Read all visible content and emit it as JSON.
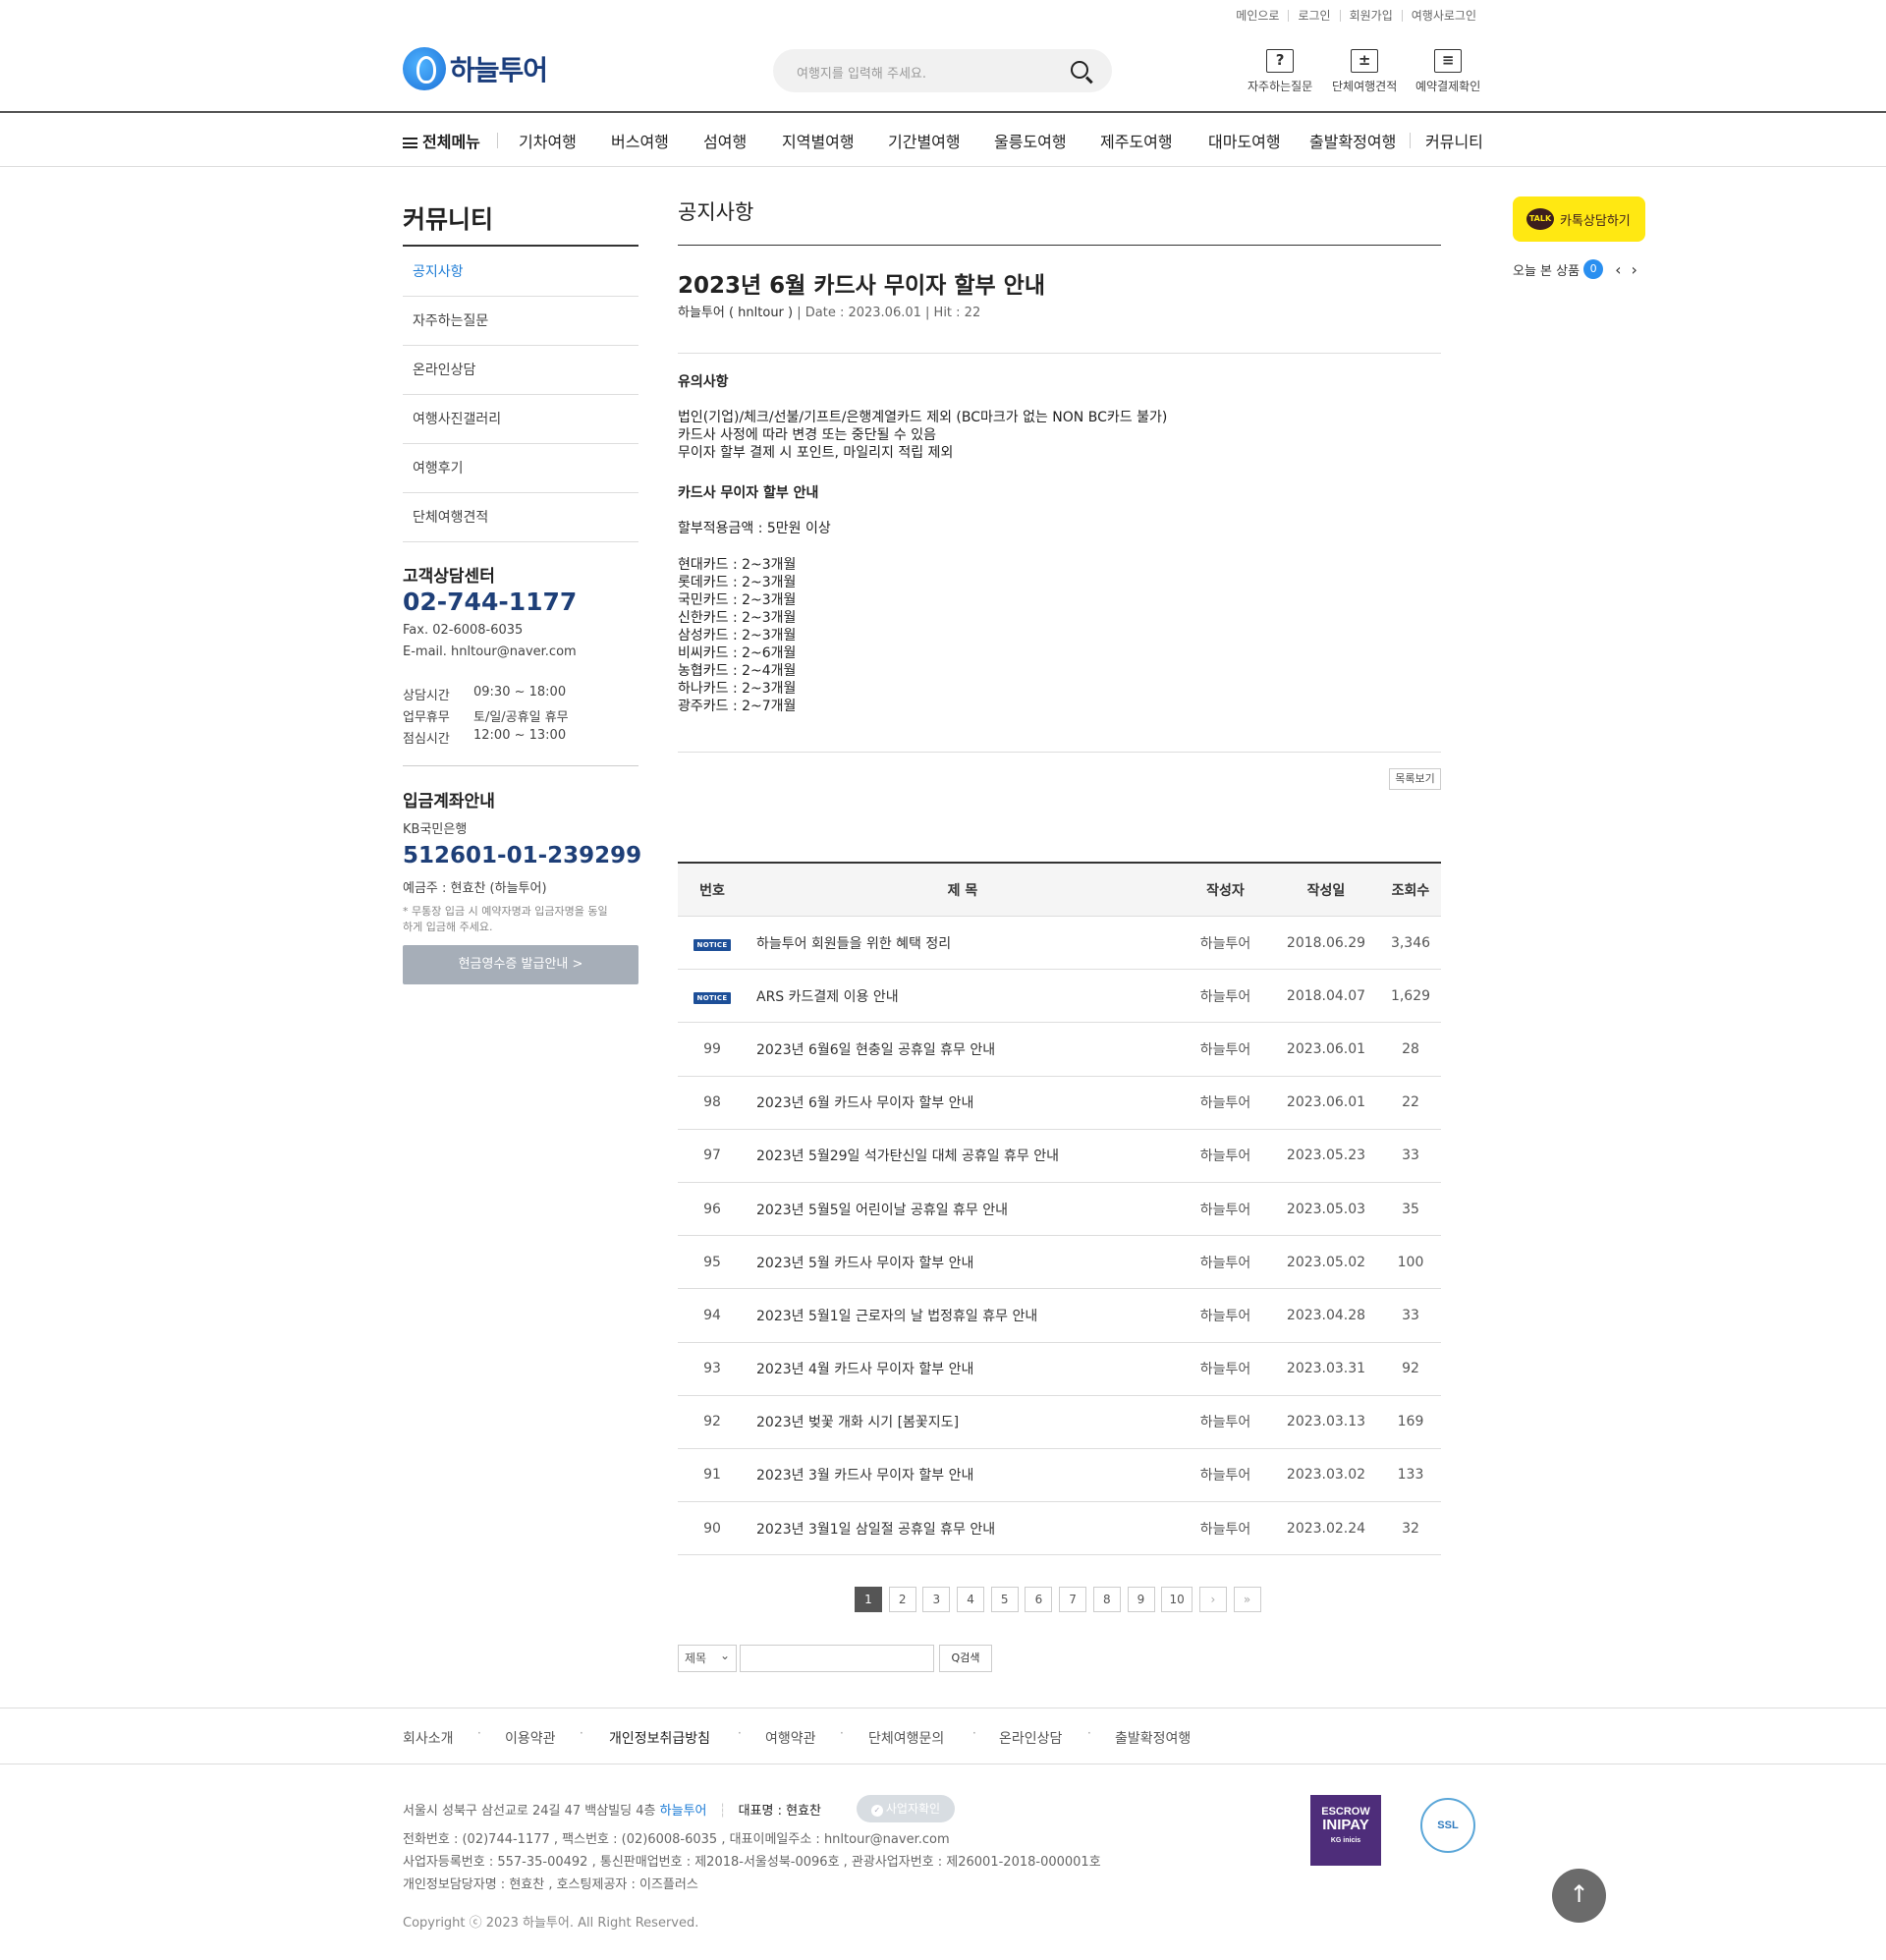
{
  "util_links": [
    "메인으로",
    "로그인",
    "회원가입",
    "여행사로그인"
  ],
  "logo": {
    "name": "하늘투어"
  },
  "search": {
    "placeholder": "여행지를 입력해 주세요."
  },
  "quick_links": [
    {
      "label": "자주하는질문",
      "icon": "?"
    },
    {
      "label": "단체여행견적",
      "icon": "±"
    },
    {
      "label": "예약결제확인",
      "icon": "≡"
    }
  ],
  "gnb": {
    "all_menu": "전체메뉴",
    "items": [
      "기차여행",
      "버스여행",
      "섬여행",
      "지역별여행",
      "기간별여행",
      "울릉도여행",
      "제주도여행",
      "대마도여행",
      "출발확정여행",
      "커뮤니티"
    ]
  },
  "sidebar": {
    "title": "커뮤니티",
    "menu": [
      "공지사항",
      "자주하는질문",
      "온라인상담",
      "여행사진갤러리",
      "여행후기",
      "단체여행견적"
    ],
    "active_index": 0,
    "cs": {
      "title": "고객상담센터",
      "tel": "02-744-1177",
      "fax": "Fax. 02-6008-6035",
      "email": "E-mail. hnltour@naver.com",
      "hours": [
        {
          "k": "상담시간",
          "v": "09:30 ~ 18:00"
        },
        {
          "k": "업무휴무",
          "v": "토/일/공휴일 휴무"
        },
        {
          "k": "점심시간",
          "v": "12:00 ~ 13:00"
        }
      ]
    },
    "account": {
      "title": "입금계좌안내",
      "bank": "KB국민은행",
      "number": "512601-01-239299",
      "holder": "예금주 : 현효찬 (하늘투어)",
      "note1": "* 무통장 입금 시 예약자명과 입금자명을 동일",
      "note2": "하게 입금해 주세요.",
      "button": "현금영수증 발급안내 >"
    }
  },
  "quick": {
    "kakao_badge": "TALK",
    "kakao": "카톡상담하기",
    "recent": "오늘 본 상품",
    "recent_count": "0",
    "prev": "‹",
    "next": "›"
  },
  "board": {
    "title": "공지사항"
  },
  "post": {
    "title": "2023년 6월 카드사 무이자 할부 안내",
    "author": "하늘투어 ( hnltour )",
    "meta": " | Date : 2023.06.01 | Hit : 22",
    "heading1": "유의사항",
    "notes": [
      "법인(기업)/체크/선불/기프트/은행계열카드 제외 (BC마크가 없는 NON BC카드 불가)",
      "카드사 사정에 따라 변경 또는 중단될 수 있음",
      "무이자 할부 결제 시 포인트, 마일리지 적립 제외"
    ],
    "heading2": "카드사 무이자 할부 안내",
    "min_amount": "할부적용금액 : 5만원 이상",
    "cards": [
      "현대카드 : 2~3개월",
      "롯데카드 : 2~3개월",
      "국민카드 : 2~3개월",
      "신한카드 : 2~3개월",
      "삼성카드 : 2~3개월",
      "비씨카드 : 2~6개월",
      "농협카드 : 2~4개월",
      "하나카드 : 2~3개월",
      "광주카드 : 2~7개월"
    ],
    "list_button": "목록보기"
  },
  "table": {
    "headers": [
      "번호",
      "제 목",
      "작성자",
      "작성일",
      "조회수"
    ],
    "notice_label": "NOTICE",
    "rows": [
      {
        "no": "NOTICE",
        "title": "하늘투어 회원들을 위한 혜택 정리",
        "author": "하늘투어",
        "date": "2018.06.29",
        "hits": "3,346"
      },
      {
        "no": "NOTICE",
        "title": "ARS 카드결제 이용 안내",
        "author": "하늘투어",
        "date": "2018.04.07",
        "hits": "1,629"
      },
      {
        "no": "99",
        "title": "2023년 6월6일 현충일 공휴일 휴무 안내",
        "author": "하늘투어",
        "date": "2023.06.01",
        "hits": "28"
      },
      {
        "no": "98",
        "title": "2023년 6월 카드사 무이자 할부 안내",
        "author": "하늘투어",
        "date": "2023.06.01",
        "hits": "22"
      },
      {
        "no": "97",
        "title": "2023년 5월29일 석가탄신일 대체 공휴일 휴무 안내",
        "author": "하늘투어",
        "date": "2023.05.23",
        "hits": "33"
      },
      {
        "no": "96",
        "title": "2023년 5월5일 어린이날 공휴일 휴무 안내",
        "author": "하늘투어",
        "date": "2023.05.03",
        "hits": "35"
      },
      {
        "no": "95",
        "title": "2023년 5월 카드사 무이자 할부 안내",
        "author": "하늘투어",
        "date": "2023.05.02",
        "hits": "100"
      },
      {
        "no": "94",
        "title": "2023년 5월1일 근로자의 날 법정휴일 휴무 안내",
        "author": "하늘투어",
        "date": "2023.04.28",
        "hits": "33"
      },
      {
        "no": "93",
        "title": "2023년 4월 카드사 무이자 할부 안내",
        "author": "하늘투어",
        "date": "2023.03.31",
        "hits": "92"
      },
      {
        "no": "92",
        "title": "2023년 벚꽃 개화 시기 [봄꽃지도]",
        "author": "하늘투어",
        "date": "2023.03.13",
        "hits": "169"
      },
      {
        "no": "91",
        "title": "2023년 3월 카드사 무이자 할부 안내",
        "author": "하늘투어",
        "date": "2023.03.02",
        "hits": "133"
      },
      {
        "no": "90",
        "title": "2023년 3월1일 삼일절 공휴일 휴무 안내",
        "author": "하늘투어",
        "date": "2023.02.24",
        "hits": "32"
      }
    ]
  },
  "paging": {
    "pages": [
      "1",
      "2",
      "3",
      "4",
      "5",
      "6",
      "7",
      "8",
      "9",
      "10"
    ],
    "current": "1",
    "next": "›",
    "last": "»"
  },
  "search_form": {
    "field": "제목",
    "button": "Q검색"
  },
  "footer": {
    "links": [
      "회사소개",
      "이용약관",
      "개인정보취급방침",
      "여행약관",
      "단체여행문의",
      "온라인상담",
      "출발확정여행"
    ],
    "address": "서울시 성북구 삼선교로 24길 47 백삼빌딩 4층",
    "company": "하늘투어",
    "ceo": "대표명 : 현효찬",
    "biz_check": "사업자확인",
    "line1": "전화번호 : (02)744-1177 , 팩스번호 : (02)6008-6035 , 대표이메일주소 : hnltour@naver.com",
    "line2": "사업자등록번호 : 557-35-00492 , 통신판매업번호 : 제2018-서울성북-0096호 , 관광사업자번호 : 제26001-2018-000001호",
    "line3": "개인정보담당자명 : 현효찬 , 호스팅제공자 : 이즈플러스",
    "copyright": "Copyright ⓒ 2023 하늘투어. All Right Reserved.",
    "escrow": [
      "ESCROW",
      "INIPAY",
      "KG inicis"
    ],
    "ssl": "SSL"
  }
}
